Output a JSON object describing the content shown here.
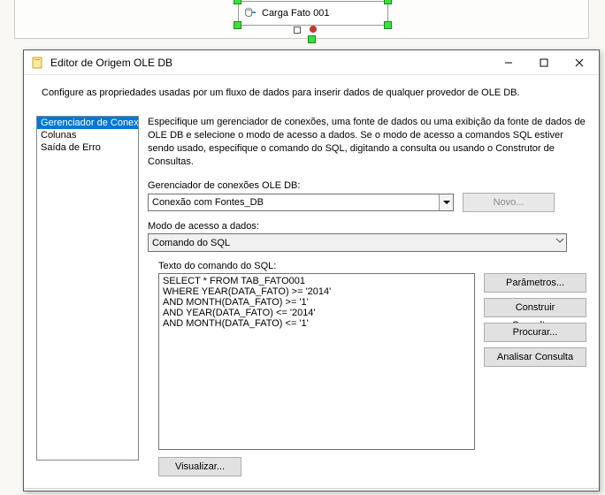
{
  "canvas": {
    "task_label": "Carga Fato 001"
  },
  "window": {
    "title": "Editor de Origem OLE DB",
    "config_text": "Configure as propriedades usadas por um fluxo de dados para inserir dados de qualquer provedor de OLE DB.",
    "nav": [
      "Gerenciador de Conexões",
      "Colunas",
      "Saída de Erro"
    ],
    "nav_selected": 0,
    "description": "Especifique um gerenciador de conexões, uma fonte de dados ou uma exibição da fonte de dados de OLE DB e selecione o modo de acesso a dados. Se o modo de acesso a comandos SQL estiver sendo usado, especifique o comando do SQL, digitando a consulta ou usando o Construtor de Consultas.",
    "conn_label": "Gerenciador de conexões OLE DB:",
    "conn_value": "Conexão com Fontes_DB",
    "new_btn": "Novo...",
    "mode_label": "Modo de acesso a dados:",
    "mode_value": "Comando do SQL",
    "sql_label": "Texto do comando do SQL:",
    "sql_text": "SELECT * FROM TAB_FATO001\nWHERE YEAR(DATA_FATO) >= '2014'\nAND MONTH(DATA_FATO) >= '1'\nAND YEAR(DATA_FATO) <= '2014'\nAND MONTH(DATA_FATO) <= '1'",
    "btn_params": "Parâmetros...",
    "btn_build": "Construir Consulta...",
    "btn_browse": "Procurar...",
    "btn_parse": "Analisar Consulta",
    "btn_preview": "Visualizar..."
  }
}
